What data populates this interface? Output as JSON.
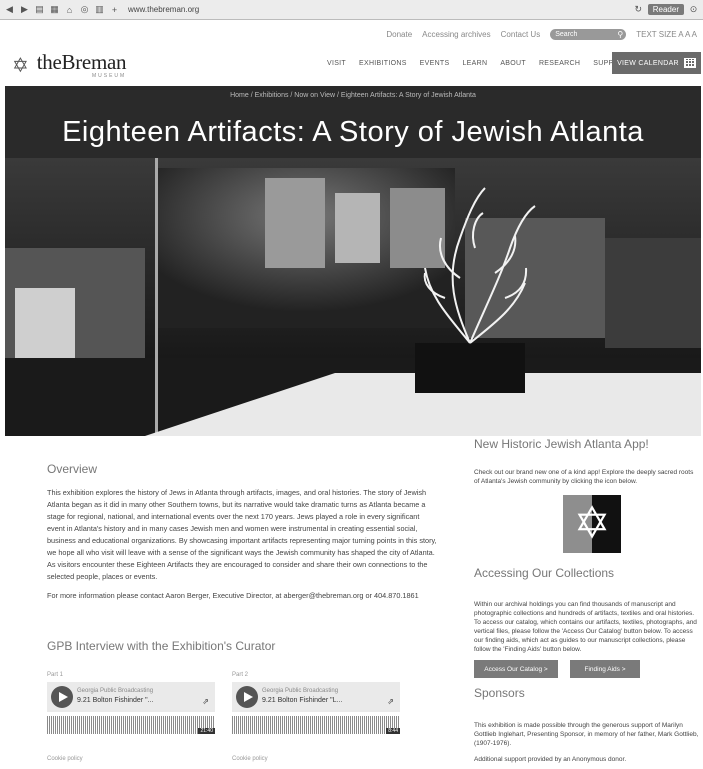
{
  "browser": {
    "url": "www.thebreman.org",
    "reader_label": "Reader"
  },
  "utility": {
    "donate": "Donate",
    "access": "Accessing archives",
    "contact": "Contact Us",
    "search_placeholder": "Search",
    "text_size": "TEXT SIZE  A  A  A"
  },
  "header": {
    "logo_name": "theBreman",
    "logo_sub": "MUSEUM",
    "nav": [
      "VISIT",
      "EXHIBITIONS",
      "EVENTS",
      "LEARN",
      "ABOUT",
      "RESEARCH",
      "SUPPORT"
    ],
    "calendar_label": "VIEW CALENDAR"
  },
  "banner": {
    "breadcrumb": "Home / Exhibitions / Now on View / Eighteen Artifacts: A Story of Jewish Atlanta",
    "title": "Eighteen Artifacts: A Story of Jewish Atlanta"
  },
  "overview": {
    "heading": "Overview",
    "text": "This exhibition explores the history of Jews in Atlanta through artifacts, images, and oral histories. The story of Jewish Atlanta began as it did in many other Southern towns, but its narrative would take dramatic turns as Atlanta became a stage for regional, national, and international events over the next 170 years. Jews played a role in every significant event in Atlanta's history and in many cases Jewish men and women were instrumental in creating essential social, business and educational organizations. By showcasing important artifacts representing major turning points in this story, we hope all who visit will leave with a sense of the significant ways the Jewish community has shaped the city of Atlanta. As visitors encounter these Eighteen Artifacts they are encouraged to consider and share their own connections to the selected people, places or events.",
    "contact": "For more information please contact Aaron Berger, Executive Director, at aberger@thebreman.org or 404.870.1861"
  },
  "gpb": {
    "heading": "GPB Interview with the Exhibition's Curator",
    "players": [
      {
        "part": "Part 1",
        "source": "Georgia Public Broadcasting",
        "title": "9.21 Bolton Fishinder \"...",
        "time": "21:40",
        "footer": "Cookie policy"
      },
      {
        "part": "Part 2",
        "source": "Georgia Public Broadcasting",
        "title": "9.21 Bolton Fishinder \"L...",
        "time": "8:44",
        "footer": "Cookie policy"
      }
    ]
  },
  "app": {
    "heading": "New Historic Jewish Atlanta App!",
    "text": "Check out our brand new one of a kind app! Explore the deeply sacred roots of Atlanta's Jewish community by clicking the icon below."
  },
  "collections": {
    "heading": "Accessing Our Collections",
    "text": "Within our archival holdings you can find thousands of manuscript and photographic collections and hundreds of artifacts, textiles and oral histories. To access our catalog, which contains our artifacts, textiles, photographs, and vertical files, please follow the 'Access Our Catalog' button below. To access our finding aids, which act as guides to our manuscript collections, please follow the 'Finding Aids' button below.",
    "btn_catalog": "Access Our Catalog >",
    "btn_finding": "Finding Aids >"
  },
  "sponsors": {
    "heading": "Sponsors",
    "text": "This exhibition is made possible through the generous support of Marilyn Gottlieb Inglehart, Presenting Sponsor, in memory of her father, Mark Gottlieb, (1907-1976).",
    "text2": "Additional support provided by an Anonymous donor."
  }
}
